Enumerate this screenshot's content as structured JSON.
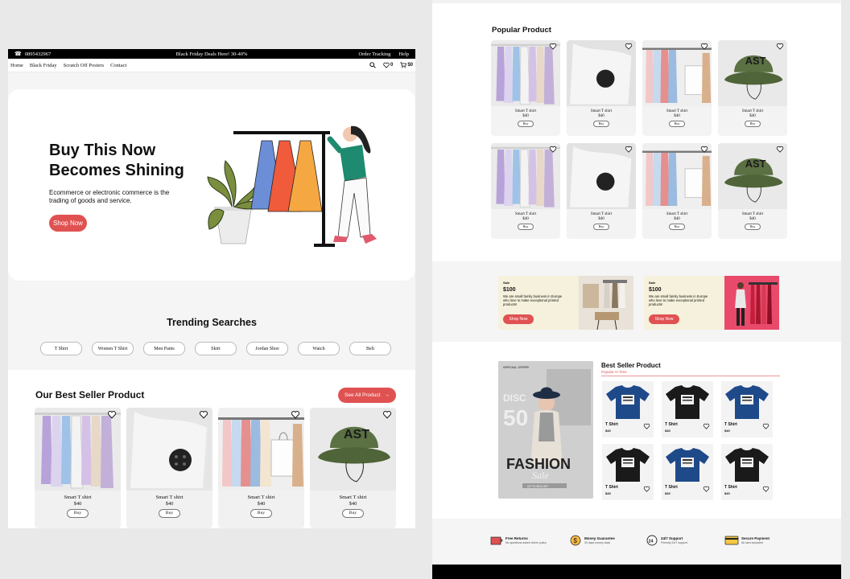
{
  "topbar": {
    "phone": "0895432967",
    "promo": "Black Friday Deals Here! 30-40%",
    "order_tracking": "Order Tracking",
    "help": "Help"
  },
  "nav": {
    "links": [
      "Home",
      "Black Friday",
      "Scratch Off Posters",
      "Contact"
    ],
    "wishlist_count": "0",
    "cart_total": "$0"
  },
  "hero": {
    "title": "Buy This Now Becomes Shining",
    "description": "Ecommerce or electronic commerce is the trading of goods and service.",
    "cta": "Shop Now"
  },
  "trending": {
    "title": "Trending Searches",
    "chips": [
      "T Shirt",
      "Women T Shirt",
      "Men Pants",
      "Skirt",
      "Jordan Shoe",
      "Watch",
      "Belt"
    ]
  },
  "best_seller": {
    "title": "Our Best Seller Product",
    "see_all": "See All Product",
    "products": [
      {
        "name": "Smart T shirt",
        "price": "$40",
        "buy": "Buy"
      },
      {
        "name": "Smart T shirt",
        "price": "$40",
        "buy": "Buy"
      },
      {
        "name": "Smart T shirt",
        "price": "$40",
        "buy": "Buy"
      },
      {
        "name": "Smart T shirt",
        "price": "$40",
        "buy": "Buy"
      }
    ]
  },
  "popular": {
    "title": "Popular Product",
    "products": [
      {
        "name": "Smart T shirt",
        "price": "$40",
        "buy": "Buy"
      },
      {
        "name": "Smart T shirt",
        "price": "$40",
        "buy": "Buy"
      },
      {
        "name": "Smart T shirt",
        "price": "$40",
        "buy": "Buy"
      },
      {
        "name": "Smart T shirt",
        "price": "$40",
        "buy": "Buy"
      },
      {
        "name": "Smart T shirt",
        "price": "$40",
        "buy": "Buy"
      },
      {
        "name": "Smart T shirt",
        "price": "$40",
        "buy": "Buy"
      },
      {
        "name": "Smart T shirt",
        "price": "$40",
        "buy": "Buy"
      },
      {
        "name": "Smart T shirt",
        "price": "$40",
        "buy": "Buy"
      }
    ]
  },
  "banners": [
    {
      "kicker": "Sale",
      "value": "$100",
      "desc": "We are small family business in Europe who love to make exceptional printed products!",
      "cta": "Shop Now"
    },
    {
      "kicker": "Sale",
      "value": "$100",
      "desc": "We are small family business in Europe who love to make exceptional printed products!",
      "cta": "Shop Now"
    }
  ],
  "sale_card": {
    "kicker": "SPECIAL OFFER",
    "disc": "DISC",
    "big": "50",
    "fashion": "FASHION",
    "sale": "Sale",
    "sub": "UP TO 50% OFF"
  },
  "best_seller_right": {
    "title": "Best Seller Product",
    "subtitle": "Popular At Time",
    "products": [
      {
        "name": "T Shirt",
        "price": "$40"
      },
      {
        "name": "T Shirt",
        "price": "$40"
      },
      {
        "name": "T Shirt",
        "price": "$40"
      },
      {
        "name": "T Shirt",
        "price": "$40"
      },
      {
        "name": "T Shirt",
        "price": "$40"
      },
      {
        "name": "T Shirt",
        "price": "$40"
      }
    ]
  },
  "features": [
    {
      "title": "Free Returns",
      "sub": "No questions asked return policy"
    },
    {
      "title": "Money Guarantee",
      "sub": "30 days money back"
    },
    {
      "title": "24/7 Support",
      "sub": "Friendly 24/7 support"
    },
    {
      "title": "Secure Payment",
      "sub": "All card accepted"
    }
  ],
  "colors": {
    "accent": "#e05252",
    "hat_green": "#5b7043",
    "navy_shirt": "#1f4a8a",
    "black_shirt": "#1a1a1a"
  }
}
